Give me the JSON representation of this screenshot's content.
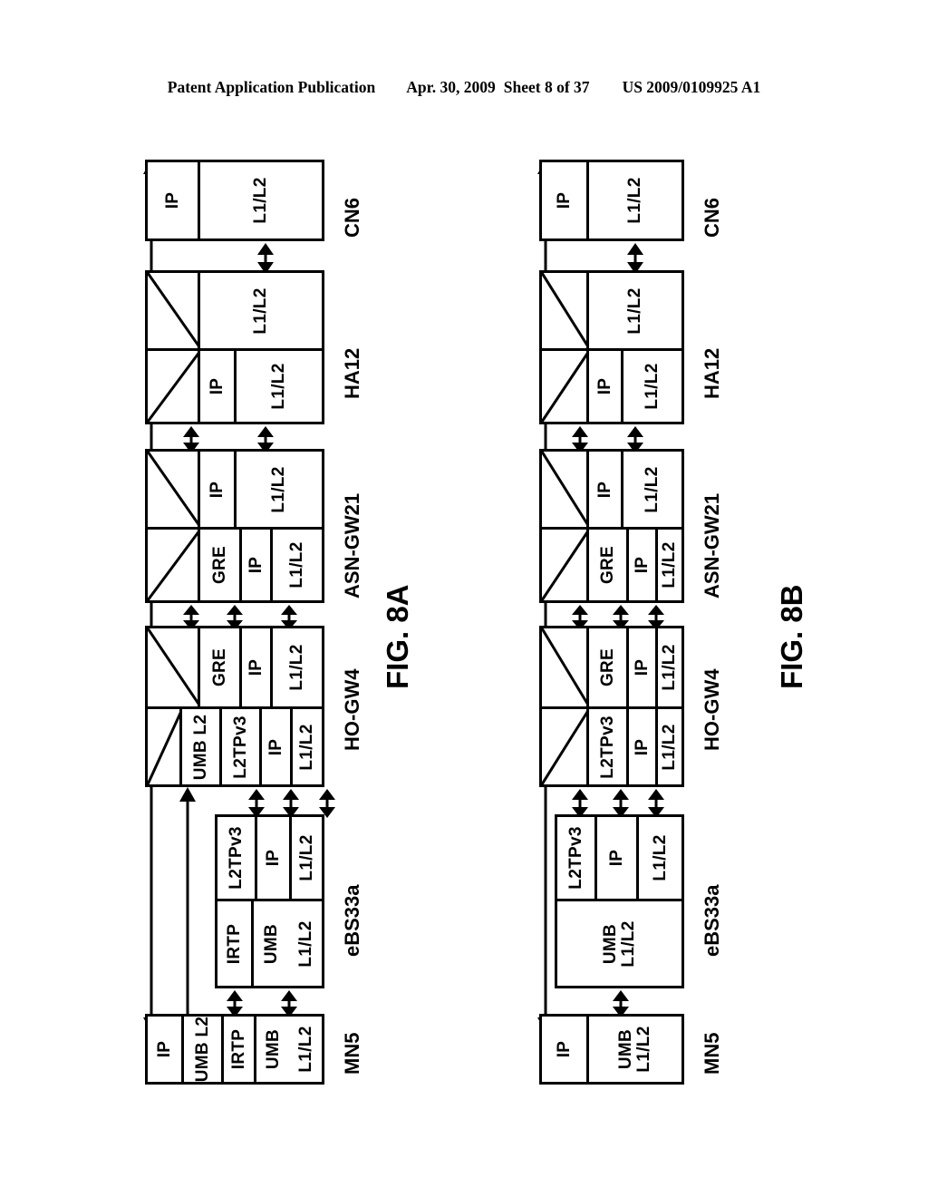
{
  "header": {
    "publication": "Patent Application Publication",
    "date": "Apr. 30, 2009",
    "sheet": "Sheet 8 of 37",
    "patent_number": "US 2009/0109925 A1"
  },
  "figures": [
    {
      "id": "fig-8a",
      "caption": "FIG. 8A",
      "nodes": [
        {
          "id": "cn6",
          "label": "CN6",
          "rows": [
            {
              "cells": [
                {
                  "text": "IP"
                },
                {
                  "text": "L1/L2"
                }
              ]
            }
          ]
        },
        {
          "id": "ha12",
          "label": "HA12",
          "rows": [
            {
              "cells": [
                {
                  "text": "",
                  "hatched": true
                },
                {
                  "text": "L1/L2"
                }
              ]
            },
            {
              "cells": [
                {
                  "text": "",
                  "hatched": true
                },
                {
                  "text": "IP"
                },
                {
                  "text": "L1/L2"
                }
              ]
            }
          ]
        },
        {
          "id": "asn-gw21",
          "label": "ASN-GW21",
          "rows": [
            {
              "cells": [
                {
                  "text": "",
                  "hatched": true
                },
                {
                  "text": "IP"
                },
                {
                  "text": "L1/L2"
                }
              ]
            },
            {
              "cells": [
                {
                  "text": "",
                  "hatched": true
                },
                {
                  "text": "GRE"
                },
                {
                  "text": "IP"
                },
                {
                  "text": "L1/L2"
                }
              ]
            }
          ]
        },
        {
          "id": "ho-gw4",
          "label": "HO-GW4",
          "rows": [
            {
              "cells": [
                {
                  "text": "",
                  "hatched": true
                },
                {
                  "text": "GRE"
                },
                {
                  "text": "IP"
                },
                {
                  "text": "L1/L2"
                }
              ]
            },
            {
              "cells": [
                {
                  "text": "",
                  "hatched": true
                },
                {
                  "text": "UMB L2"
                },
                {
                  "text": "L2TPv3"
                },
                {
                  "text": "IP"
                },
                {
                  "text": "L1/L2"
                }
              ]
            }
          ]
        },
        {
          "id": "ebs33a",
          "label": "eBS33a",
          "rows": [
            {
              "cells": [
                {
                  "text": "L2TPv3"
                },
                {
                  "text": "IP"
                },
                {
                  "text": "L1/L2"
                }
              ]
            },
            {
              "cells": [
                {
                  "text": "IRTP"
                },
                {
                  "text": "UMB"
                },
                {
                  "text": "L1/L2"
                }
              ]
            }
          ]
        },
        {
          "id": "mn5",
          "label": "MN5",
          "rows": [
            {
              "cells": [
                {
                  "text": "IP"
                },
                {
                  "text": "UMB L2"
                },
                {
                  "text": "IRTP"
                },
                {
                  "text": "UMB"
                },
                {
                  "text": "L1/L2"
                }
              ]
            }
          ]
        }
      ]
    },
    {
      "id": "fig-8b",
      "caption": "FIG. 8B",
      "nodes": [
        {
          "id": "cn6",
          "label": "CN6",
          "rows": [
            {
              "cells": [
                {
                  "text": "IP"
                },
                {
                  "text": "L1/L2"
                }
              ]
            }
          ]
        },
        {
          "id": "ha12",
          "label": "HA12",
          "rows": [
            {
              "cells": [
                {
                  "text": "",
                  "hatched": true
                },
                {
                  "text": "L1/L2"
                }
              ]
            },
            {
              "cells": [
                {
                  "text": "",
                  "hatched": true
                },
                {
                  "text": "IP"
                },
                {
                  "text": "L1/L2"
                }
              ]
            }
          ]
        },
        {
          "id": "asn-gw21",
          "label": "ASN-GW21",
          "rows": [
            {
              "cells": [
                {
                  "text": "",
                  "hatched": true
                },
                {
                  "text": "IP"
                },
                {
                  "text": "L1/L2"
                }
              ]
            },
            {
              "cells": [
                {
                  "text": "",
                  "hatched": true
                },
                {
                  "text": "GRE"
                },
                {
                  "text": "IP"
                },
                {
                  "text": "L1/L2"
                }
              ]
            }
          ]
        },
        {
          "id": "ho-gw4",
          "label": "HO-GW4",
          "rows": [
            {
              "cells": [
                {
                  "text": "",
                  "hatched": true
                },
                {
                  "text": "GRE"
                },
                {
                  "text": "IP"
                },
                {
                  "text": "L1/L2"
                }
              ]
            },
            {
              "cells": [
                {
                  "text": "",
                  "hatched": true
                },
                {
                  "text": "L2TPv3"
                },
                {
                  "text": "IP"
                },
                {
                  "text": "L1/L2"
                }
              ]
            }
          ]
        },
        {
          "id": "ebs33a",
          "label": "eBS33a",
          "rows": [
            {
              "cells": [
                {
                  "text": "L2TPv3"
                },
                {
                  "text": "IP"
                },
                {
                  "text": "L1/L2"
                }
              ]
            },
            {
              "cells": [
                {
                  "text": "UMB\nL1/L2"
                }
              ]
            }
          ]
        },
        {
          "id": "mn5",
          "label": "MN5",
          "rows": [
            {
              "cells": [
                {
                  "text": "IP"
                },
                {
                  "text": "UMB\nL1/L2"
                }
              ]
            }
          ]
        }
      ]
    }
  ],
  "labels": {
    "fig8a": {
      "cn6": "CN6",
      "ha12": "HA12",
      "asn_gw21": "ASN-GW21",
      "ho_gw4": "HO-GW4",
      "ebs33a": "eBS33a",
      "mn5": "MN5",
      "caption": "FIG. 8A",
      "cn6_ip": "IP",
      "cn6_l1l2": "L1/L2",
      "ha12_top_l1l2": "L1/L2",
      "ha12_bot_ip": "IP",
      "ha12_bot_l1l2": "L1/L2",
      "asn_top_ip": "IP",
      "asn_top_l1l2": "L1/L2",
      "asn_bot_gre": "GRE",
      "asn_bot_ip": "IP",
      "asn_bot_l1l2": "L1/L2",
      "ho_top_gre": "GRE",
      "ho_top_ip": "IP",
      "ho_top_l1l2": "L1/L2",
      "ho_bot_umbl2": "UMB L2",
      "ho_bot_l2tpv3": "L2TPv3",
      "ho_bot_ip": "IP",
      "ho_bot_l1l2": "L1/L2",
      "ebs_top_l2tpv3": "L2TPv3",
      "ebs_top_ip": "IP",
      "ebs_top_l1l2": "L1/L2",
      "ebs_bot_irtp": "IRTP",
      "ebs_bot_umb": "UMB",
      "ebs_bot_l1l2": "L1/L2",
      "mn5_ip": "IP",
      "mn5_umbl2": "UMB L2",
      "mn5_irtp": "IRTP",
      "mn5_umb": "UMB",
      "mn5_l1l2": "L1/L2"
    },
    "fig8b": {
      "cn6": "CN6",
      "ha12": "HA12",
      "asn_gw21": "ASN-GW21",
      "ho_gw4": "HO-GW4",
      "ebs33a": "eBS33a",
      "mn5": "MN5",
      "caption": "FIG. 8B",
      "cn6_ip": "IP",
      "cn6_l1l2": "L1/L2",
      "ha12_top_l1l2": "L1/L2",
      "ha12_bot_ip": "IP",
      "ha12_bot_l1l2": "L1/L2",
      "asn_top_ip": "IP",
      "asn_top_l1l2": "L1/L2",
      "asn_bot_gre": "GRE",
      "asn_bot_ip": "IP",
      "asn_bot_l1l2": "L1/L2",
      "ho_top_gre": "GRE",
      "ho_top_ip": "IP",
      "ho_top_l1l2": "L1/L2",
      "ho_bot_l2tpv3": "L2TPv3",
      "ho_bot_ip": "IP",
      "ho_bot_l1l2": "L1/L2",
      "ebs_top_l2tpv3": "L2TPv3",
      "ebs_top_ip": "IP",
      "ebs_top_l1l2": "L1/L2",
      "ebs_bot_umb": "UMB\nL1/L2",
      "mn5_ip": "IP",
      "mn5_umb": "UMB\nL1/L2"
    }
  },
  "colors": {
    "ink": "#000000",
    "paper": "#ffffff"
  }
}
